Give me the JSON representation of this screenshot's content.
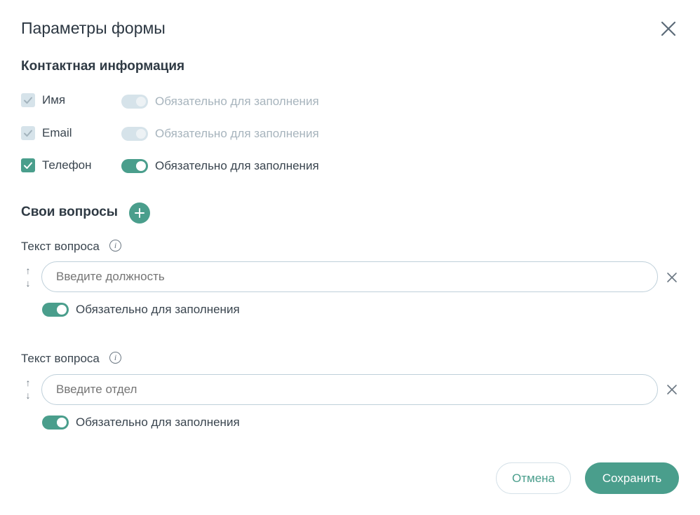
{
  "dialog": {
    "title": "Параметры формы",
    "close_icon": "close-icon"
  },
  "contact": {
    "section_title": "Контактная информация",
    "fields": [
      {
        "label": "Имя",
        "checked": true,
        "disabled": true,
        "required_label": "Обязательно для заполнения",
        "required": true,
        "required_disabled": true
      },
      {
        "label": "Email",
        "checked": true,
        "disabled": true,
        "required_label": "Обязательно для заполнения",
        "required": true,
        "required_disabled": true
      },
      {
        "label": "Телефон",
        "checked": true,
        "disabled": false,
        "required_label": "Обязательно для заполнения",
        "required": true,
        "required_disabled": false
      }
    ]
  },
  "custom": {
    "section_title": "Свои вопросы",
    "add_icon": "plus-icon",
    "questions": [
      {
        "label": "Текст вопроса",
        "info_icon": "info-icon",
        "info_glyph": "i",
        "placeholder": "Введите должность",
        "value": "",
        "required_label": "Обязательно для заполнения",
        "required": true
      },
      {
        "label": "Текст вопроса",
        "info_icon": "info-icon",
        "info_glyph": "i",
        "placeholder": "Введите отдел",
        "value": "",
        "required_label": "Обязательно для заполнения",
        "required": true
      }
    ],
    "move_up_glyph": "↑",
    "move_down_glyph": "↓"
  },
  "footer": {
    "cancel_label": "Отмена",
    "save_label": "Сохранить"
  },
  "colors": {
    "accent": "#4a9e8c",
    "disabled": "#d6e3ea",
    "border": "#bfd0da"
  }
}
